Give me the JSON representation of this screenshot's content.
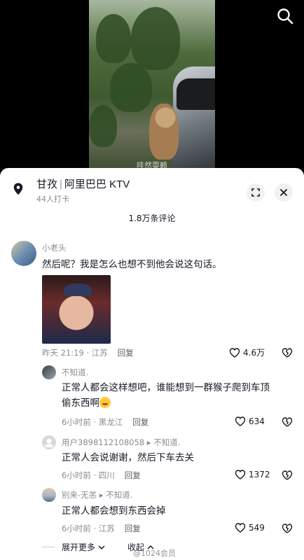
{
  "video": {
    "caption": "哇然耍赖"
  },
  "sheet": {
    "location": {
      "place": "甘孜",
      "separator": "|",
      "name": "阿里巴巴 KTV",
      "checkins": "44人打卡"
    },
    "comment_count": "1.8万条评论",
    "comments": [
      {
        "name": "小老头",
        "text": "然后呢？我是怎么也想不到他会说这句话。",
        "time": "昨天 21:19 · 江苏",
        "reply": "回复",
        "likes": "4.6万"
      },
      {
        "name": "不知道.",
        "text": "正常人都会这样想吧，谁能想到一群猴子爬到车顶偷东西啊",
        "time": "6小时前 · 黑龙江",
        "reply": "回复",
        "likes": "634"
      },
      {
        "name": "用户3898112108058 ▸ 不知道.",
        "text": "正常人会说谢谢，然后下车去关",
        "time": "6小时前 · 四川",
        "reply": "回复",
        "likes": "1372"
      },
      {
        "name": "别来-无恙 ▸ 不知道.",
        "text": "正常人都会想到东西会掉",
        "time": "6小时前 · 江苏",
        "reply": "回复",
        "likes": "549"
      }
    ],
    "expand_more": "展开更多",
    "collapse": "收起",
    "watermark": "@1024会员"
  },
  "colors": {
    "text": "#161823",
    "secondary": "#8a8b91",
    "sheet": "#ffffff"
  }
}
